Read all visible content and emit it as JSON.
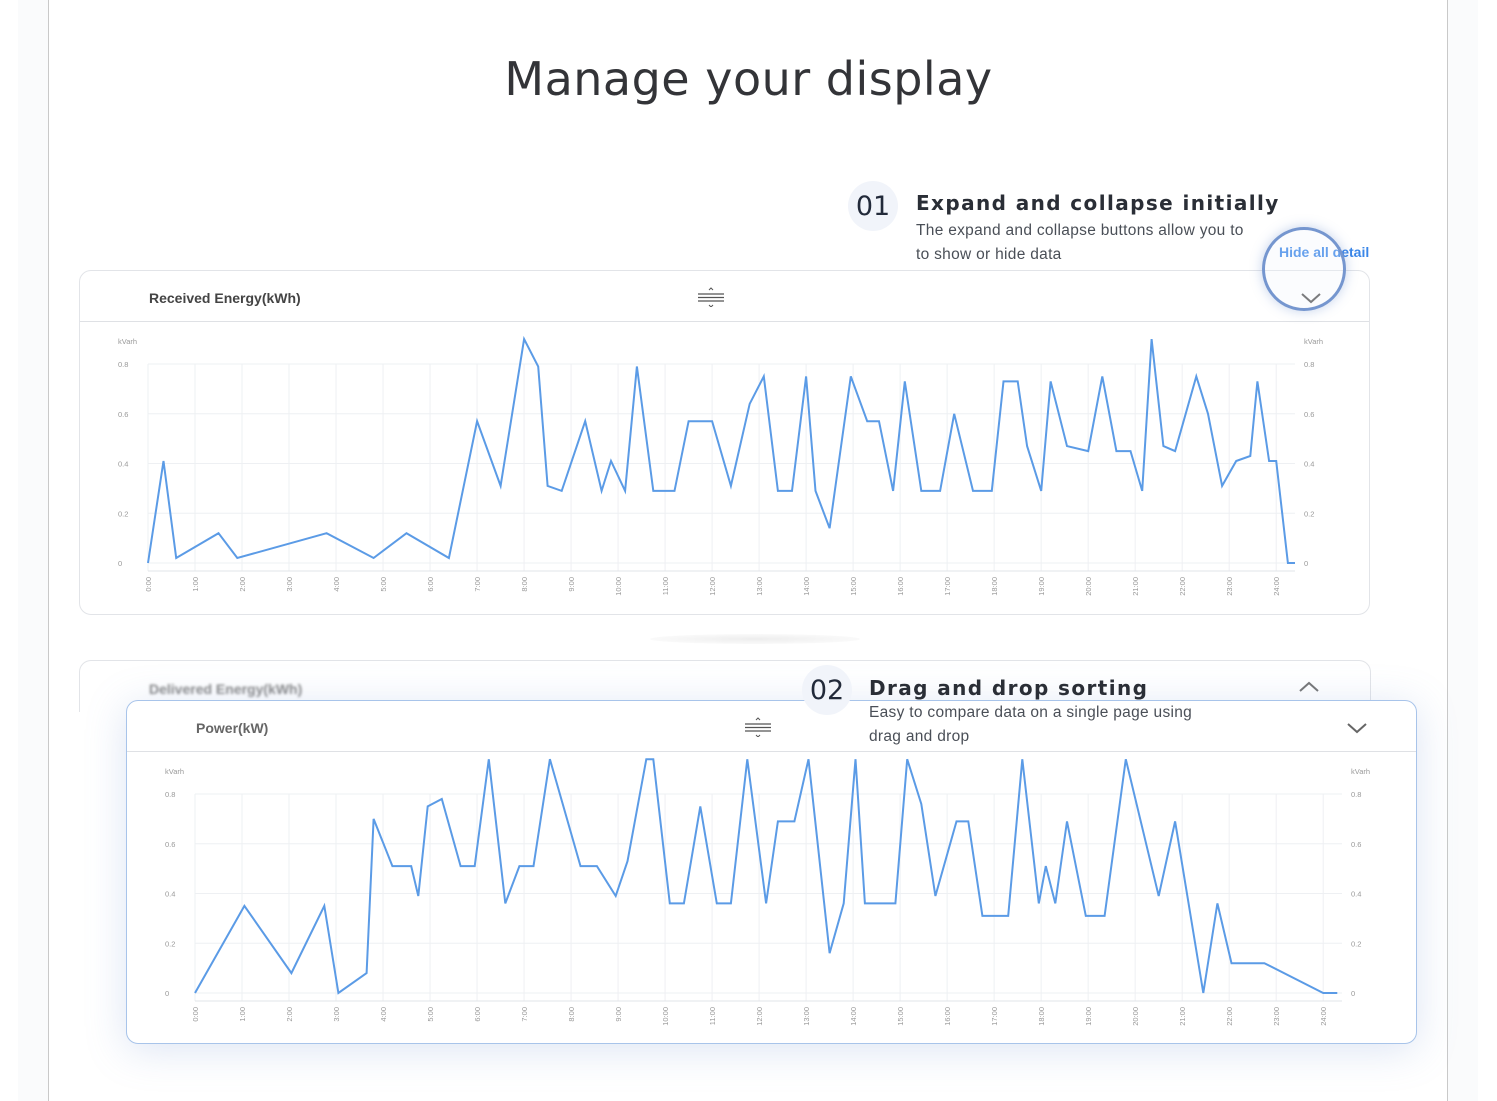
{
  "page": {
    "title": "Manage your display"
  },
  "features": [
    {
      "number": "01",
      "title": "Expand and collapse initially",
      "description": "The expand and collapse buttons allow you to to show or hide data"
    },
    {
      "number": "02",
      "title": "Drag and drop sorting",
      "description": "Easy to compare data on a single page using drag and drop"
    }
  ],
  "controls": {
    "hide_all_detail": "Hide all detail"
  },
  "cards": {
    "received": {
      "title": "Received Energy(kWh)"
    },
    "delivered": {
      "title": "Delivered Energy(kWh)"
    },
    "power": {
      "title": "Power(kW)"
    }
  },
  "icons": {
    "drag": "drag-handle-icon",
    "collapse": "chevron-down-icon",
    "expand": "chevron-up-icon"
  },
  "colors": {
    "line": "#5b9be6",
    "accent": "#3a86e8",
    "title": "#333438"
  },
  "chart_data": [
    {
      "type": "line",
      "name": "received",
      "unit_label": "kVarh",
      "y_ticks": [
        "0",
        "0.2",
        "0.4",
        "0.6",
        "0.8"
      ],
      "ylim": [
        0,
        0.8
      ],
      "x_ticks": [
        "0:00",
        "1:00",
        "2:00",
        "3:00",
        "4:00",
        "5:00",
        "6:00",
        "7:00",
        "8:00",
        "9:00",
        "10:00",
        "11:00",
        "12:00",
        "13:00",
        "14:00",
        "15:00",
        "16:00",
        "17:00",
        "18:00",
        "19:00",
        "20:00",
        "21:00",
        "22:00",
        "23:00",
        "24:00"
      ],
      "xlim": [
        0,
        24.4
      ],
      "grid": true,
      "x": [
        0,
        0.33,
        0.6,
        1.5,
        1.9,
        3.8,
        4.8,
        5.5,
        6.4,
        7,
        7.5,
        8,
        8.3,
        8.5,
        8.8,
        9.3,
        9.65,
        9.85,
        10.15,
        10.4,
        10.75,
        11.2,
        11.5,
        12,
        12.4,
        12.8,
        13.1,
        13.4,
        13.7,
        14,
        14.2,
        14.5,
        14.95,
        15.3,
        15.55,
        15.85,
        16.1,
        16.45,
        16.85,
        17.15,
        17.55,
        17.95,
        18.2,
        18.5,
        18.7,
        19,
        19.2,
        19.55,
        20,
        20.3,
        20.6,
        20.9,
        21.15,
        21.35,
        21.6,
        21.85,
        22.3,
        22.55,
        22.85,
        23.15,
        23.45,
        23.6,
        23.85,
        24,
        24.25,
        24.4
      ],
      "y": [
        0,
        0.41,
        0.02,
        0.12,
        0.02,
        0.12,
        0.02,
        0.12,
        0.02,
        0.57,
        0.31,
        0.9,
        0.79,
        0.31,
        0.29,
        0.57,
        0.29,
        0.41,
        0.29,
        0.79,
        0.29,
        0.29,
        0.57,
        0.57,
        0.31,
        0.64,
        0.75,
        0.29,
        0.29,
        0.75,
        0.29,
        0.14,
        0.75,
        0.57,
        0.57,
        0.29,
        0.73,
        0.29,
        0.29,
        0.6,
        0.29,
        0.29,
        0.73,
        0.73,
        0.47,
        0.29,
        0.73,
        0.47,
        0.45,
        0.75,
        0.45,
        0.45,
        0.29,
        0.9,
        0.47,
        0.45,
        0.75,
        0.6,
        0.31,
        0.41,
        0.43,
        0.73,
        0.41,
        0.41,
        0,
        0
      ]
    },
    {
      "type": "line",
      "name": "power",
      "unit_label": "kVarh",
      "y_ticks": [
        "0",
        "0.2",
        "0.4",
        "0.6",
        "0.8"
      ],
      "ylim": [
        0,
        0.8
      ],
      "x_ticks": [
        "0:00",
        "1:00",
        "2:00",
        "3:00",
        "4:00",
        "5:00",
        "6:00",
        "7:00",
        "8:00",
        "9:00",
        "10:00",
        "11:00",
        "12:00",
        "13:00",
        "14:00",
        "15:00",
        "16:00",
        "17:00",
        "18:00",
        "19:00",
        "20:00",
        "21:00",
        "22:00",
        "23:00",
        "24:00"
      ],
      "xlim": [
        0,
        24.4
      ],
      "grid": true,
      "x": [
        0,
        1.05,
        2.05,
        2.75,
        3.05,
        3.65,
        3.8,
        4.2,
        4.6,
        4.75,
        4.95,
        5.25,
        5.65,
        5.95,
        6.25,
        6.6,
        6.9,
        7.2,
        7.55,
        8.2,
        8.55,
        8.95,
        9.2,
        9.6,
        9.75,
        10.1,
        10.4,
        10.75,
        11.1,
        11.4,
        11.75,
        12.15,
        12.4,
        12.75,
        13.05,
        13.5,
        13.8,
        14.05,
        14.25,
        14.9,
        15.15,
        15.45,
        15.75,
        16.2,
        16.45,
        16.75,
        17.3,
        17.6,
        17.95,
        18.1,
        18.3,
        18.55,
        18.95,
        19.35,
        19.8,
        20.5,
        20.85,
        21.45,
        21.75,
        22.05,
        22.75,
        24,
        24.3
      ],
      "y": [
        0,
        0.35,
        0.08,
        0.35,
        0,
        0.08,
        0.7,
        0.51,
        0.51,
        0.39,
        0.75,
        0.78,
        0.51,
        0.51,
        0.94,
        0.36,
        0.51,
        0.51,
        0.94,
        0.51,
        0.51,
        0.39,
        0.53,
        0.94,
        0.94,
        0.36,
        0.36,
        0.75,
        0.36,
        0.36,
        0.94,
        0.36,
        0.69,
        0.69,
        0.94,
        0.16,
        0.36,
        0.94,
        0.36,
        0.36,
        0.94,
        0.76,
        0.39,
        0.69,
        0.69,
        0.31,
        0.31,
        0.94,
        0.36,
        0.51,
        0.36,
        0.69,
        0.31,
        0.31,
        0.94,
        0.39,
        0.69,
        0,
        0.36,
        0.12,
        0.12,
        0,
        0
      ]
    }
  ]
}
